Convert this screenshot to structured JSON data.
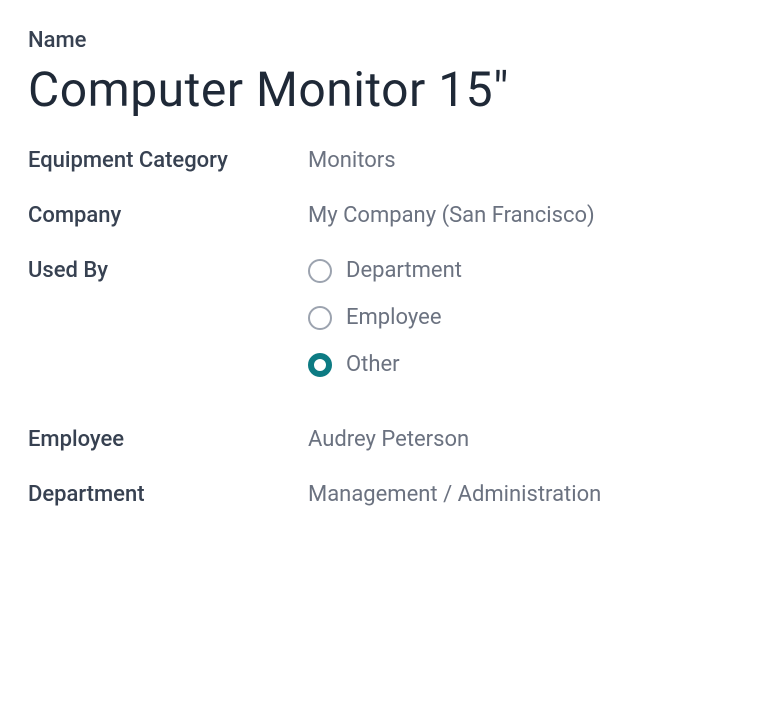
{
  "name": {
    "label": "Name",
    "value": "Computer Monitor 15\""
  },
  "equipment_category": {
    "label": "Equipment Category",
    "value": "Monitors"
  },
  "company": {
    "label": "Company",
    "value": "My Company (San Francisco)"
  },
  "used_by": {
    "label": "Used By",
    "options": [
      {
        "label": "Department",
        "selected": false
      },
      {
        "label": "Employee",
        "selected": false
      },
      {
        "label": "Other",
        "selected": true
      }
    ]
  },
  "employee": {
    "label": "Employee",
    "value": "Audrey Peterson"
  },
  "department": {
    "label": "Department",
    "value": "Management / Administration"
  }
}
